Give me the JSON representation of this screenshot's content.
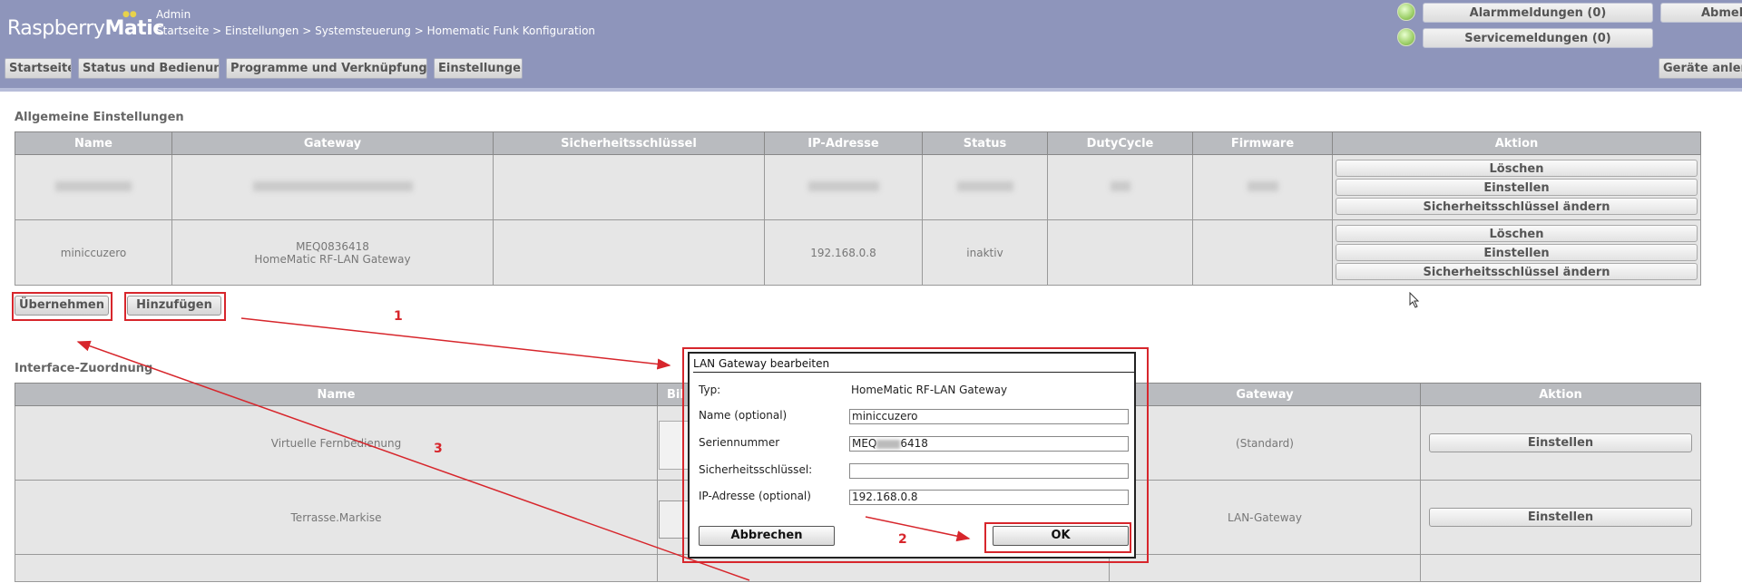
{
  "header": {
    "logo_light": "Raspberry",
    "logo_bold": "Matic",
    "user": "Admin",
    "breadcrumb": "Startseite > Einstellungen > Systemsteuerung > Homematic Funk Konfiguration",
    "alarm_label": "Alarmmeldungen (0)",
    "service_label": "Servicemeldungen (0)",
    "logout_label": "Abmelden",
    "pair_label": "Geräte anlernen",
    "status_led_color": "#9ed06a"
  },
  "nav": {
    "home": "Startseite",
    "status": "Status und Bedienung",
    "programs": "Programme und Verknüpfungen",
    "settings": "Einstellungen"
  },
  "general": {
    "title": "Allgemeine Einstellungen",
    "columns": [
      "Name",
      "Gateway",
      "Sicherheitsschlüssel",
      "IP-Adresse",
      "Status",
      "DutyCycle",
      "Firmware",
      "Aktion"
    ],
    "rows": [
      {
        "name": "miniccuzero",
        "gateway_serial": "MEQ0836418",
        "gateway_type": "HomeMatic RF-LAN Gateway",
        "key": "",
        "ip": "192.168.0.8",
        "status": "inaktiv",
        "dutycycle": "",
        "firmware": ""
      }
    ],
    "action_delete": "Löschen",
    "action_settings": "Einstellen",
    "action_change_key": "Sicherheitsschlüssel ändern",
    "apply_label": "Übernehmen",
    "add_label": "Hinzufügen"
  },
  "interface": {
    "title": "Interface-Zuordnung",
    "columns": [
      "Name",
      "Bild",
      "Gateway",
      "Aktion"
    ],
    "col_image_visible": "Bil",
    "rows": [
      {
        "name": "Virtuelle Fernbedienung",
        "gateway": "(Standard)"
      },
      {
        "name": "Terrasse.Markise",
        "gateway": "LAN-Gateway"
      }
    ],
    "action_settings": "Einstellen"
  },
  "dialog": {
    "title": "LAN Gateway bearbeiten",
    "type_label": "Typ:",
    "type_value": "HomeMatic RF-LAN Gateway",
    "name_label": "Name (optional)",
    "name_value": "miniccuzero",
    "serial_label": "Seriennummer",
    "serial_prefix": "MEQ",
    "serial_suffix": "6418",
    "key_label": "Sicherheitsschlüssel:",
    "key_value": "",
    "ip_label": "IP-Adresse (optional)",
    "ip_value": "192.168.0.8",
    "cancel_label": "Abbrechen",
    "ok_label": "OK"
  },
  "annotations": {
    "step1": "1",
    "step2": "2",
    "step3": "3",
    "color": "#d7262c"
  }
}
